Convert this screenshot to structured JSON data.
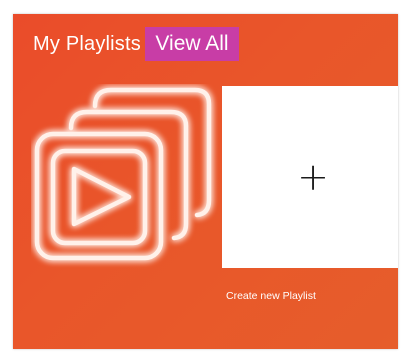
{
  "header": {
    "title": "My Playlists",
    "view_all_label": "View All"
  },
  "create_playlist": {
    "icon": "plus-icon",
    "plus_symbol": "+",
    "label": "Create new Playlist"
  },
  "playlist_art": {
    "icon": "stacked-play-icon"
  },
  "colors": {
    "panel_background": "#E9552A",
    "view_all_background": "#C83DA6",
    "card_background": "#FFFFFF",
    "text": "#FFFFFF"
  }
}
